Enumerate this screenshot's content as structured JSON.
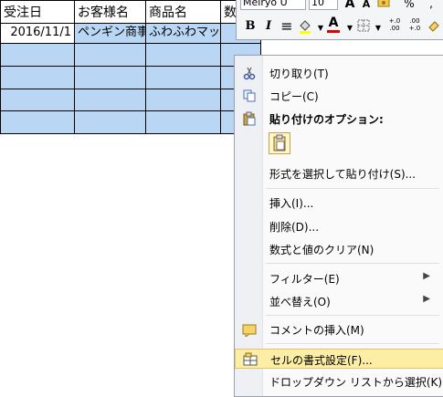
{
  "sheet": {
    "headers": [
      "受注日",
      "お客様名",
      "商品名",
      "数"
    ],
    "rows": [
      [
        "2016/11/1",
        "ペンギン商事",
        "ふわふわマット",
        ""
      ],
      [
        "",
        "",
        "",
        ""
      ],
      [
        "",
        "",
        "",
        ""
      ],
      [
        "",
        "",
        "",
        ""
      ],
      [
        "",
        "",
        "",
        ""
      ]
    ]
  },
  "minibar": {
    "font": "Meiryo U",
    "size": "10",
    "bold": "B",
    "italic": "I",
    "align": "≡",
    "font_color": "A",
    "percent": "%",
    "decimal_inc": "+.0\n.00",
    "decimal_dec": ".00\n+.0"
  },
  "menu": {
    "items": [
      {
        "label": "切り取り(T)",
        "icon": "scissors-icon"
      },
      {
        "label": "コピー(C)",
        "icon": "copy-icon"
      },
      {
        "label": "貼り付けのオプション:",
        "icon": "paste-icon"
      },
      {
        "label": "形式を選択して貼り付け(S)...",
        "icon": ""
      },
      {
        "label": "挿入(I)...",
        "icon": ""
      },
      {
        "label": "削除(D)...",
        "icon": ""
      },
      {
        "label": "数式と値のクリア(N)",
        "icon": ""
      },
      {
        "label": "フィルター(E)",
        "icon": ""
      },
      {
        "label": "並べ替え(O)",
        "icon": ""
      },
      {
        "label": "コメントの挿入(M)",
        "icon": "comment-icon"
      },
      {
        "label": "セルの書式設定(F)...",
        "icon": "format-cells-icon"
      },
      {
        "label": "ドロップダウン リストから選択(K)...",
        "icon": ""
      }
    ]
  },
  "colors": {
    "selection": "#b9d7f5",
    "highlight": "#fdeea6",
    "highlight_border": "#e5c365"
  }
}
